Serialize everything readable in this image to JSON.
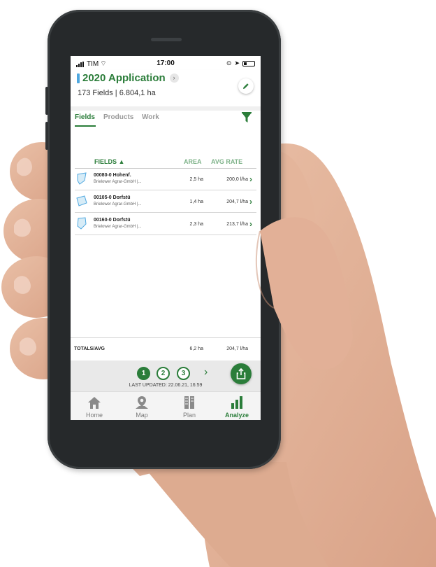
{
  "status_bar": {
    "carrier": "TIM",
    "time": "17:00"
  },
  "header": {
    "title": "2020 Application",
    "subtitle": "173 Fields | 6.804,1 ha",
    "title_chevron": "›",
    "edit_icon": "pencil-icon"
  },
  "tabs": [
    {
      "label": "Fields",
      "active": true
    },
    {
      "label": "Products",
      "active": false
    },
    {
      "label": "Work",
      "active": false
    }
  ],
  "table": {
    "columns": {
      "fields": "FIELDS ▲",
      "area": "AREA",
      "rate": "AVG RATE"
    },
    "rows": [
      {
        "name": "00080-0 Hohenf.",
        "company": "Brielower Agrar-GmbH |...",
        "area": "2,5 ha",
        "rate": "200,0 l/ha"
      },
      {
        "name": "00105-0 Dorfstü",
        "company": "Brielower Agrar-GmbH |...",
        "area": "1,4 ha",
        "rate": "204,7 l/ha"
      },
      {
        "name": "00160-0 Dorfstü",
        "company": "Brielower Agrar-GmbH |...",
        "area": "2,3 ha",
        "rate": "213,7 l/ha"
      }
    ],
    "totals": {
      "label": "TOTALS/AVG",
      "area": "6,2 ha",
      "rate": "204,7 l/ha"
    }
  },
  "action_bar": {
    "steps": [
      "1",
      "2",
      "3"
    ],
    "current_step": 1,
    "next": "›",
    "last_updated": "LAST UPDATED: 22.06.21, 16:59"
  },
  "bottom_nav": [
    {
      "label": "Home",
      "icon": "home-icon",
      "active": false
    },
    {
      "label": "Map",
      "icon": "map-pin-icon",
      "active": false
    },
    {
      "label": "Plan",
      "icon": "plan-icon",
      "active": false
    },
    {
      "label": "Analyze",
      "icon": "bar-chart-icon",
      "active": true
    }
  ],
  "colors": {
    "accent": "#2b7d3a",
    "accent_light": "#7fb38a",
    "marker": "#4fa8e0",
    "phone": "#26292b"
  }
}
